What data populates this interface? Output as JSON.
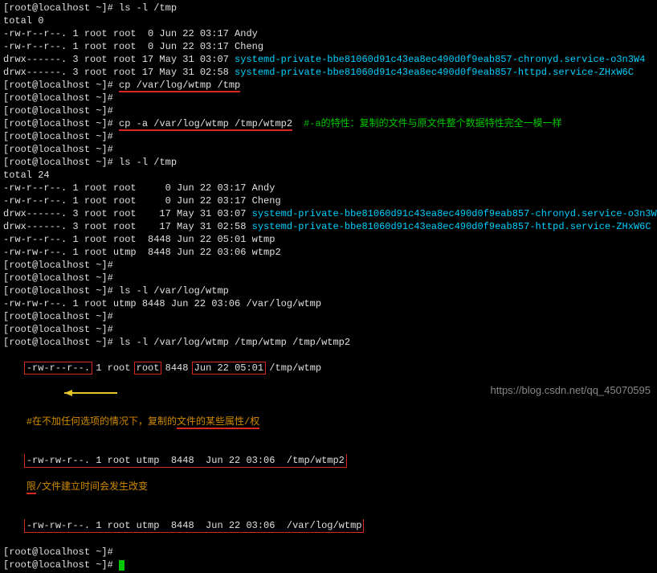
{
  "prompt": "[root@localhost ~]# ",
  "cmd": {
    "ls1": "ls -l /tmp",
    "cp1": "cp /var/log/wtmp /tmp",
    "cp2": "cp -a /var/log/wtmp /tmp/wtmp2",
    "ls2": "ls -l /tmp",
    "ls3": "ls -l /var/log/wtmp",
    "ls4": "ls -l /var/log/wtmp /tmp/wtmp /tmp/wtmp2"
  },
  "out": {
    "total0": "total 0",
    "total24": "total 24",
    "l01": "-rw-r--r--. 1 root root  0 Jun 22 03:17 Andy",
    "l02": "-rw-r--r--. 1 root root  0 Jun 22 03:17 Cheng",
    "l03a": "drwx------. 3 root root 17 May 31 03:07 ",
    "l03b": "systemd-private-bbe81060d91c43ea8ec490d0f9eab857-chronyd.service-o3n3W4",
    "l04a": "drwx------. 3 root root 17 May 31 02:58 ",
    "l04b": "systemd-private-bbe81060d91c43ea8ec490d0f9eab857-httpd.service-ZHxW6C",
    "l11": "-rw-r--r--. 1 root root     0 Jun 22 03:17 Andy",
    "l12": "-rw-r--r--. 1 root root     0 Jun 22 03:17 Cheng",
    "l13a": "drwx------. 3 root root    17 May 31 03:07 ",
    "l14a": "drwx------. 3 root root    17 May 31 02:58 ",
    "l15": "-rw-r--r--. 1 root root  8448 Jun 22 05:01 wtmp",
    "l16": "-rw-rw-r--. 1 root utmp  8448 Jun 22 03:06 wtmp2",
    "l21": "-rw-rw-r--. 1 root utmp 8448 Jun 22 03:06 /var/log/wtmp",
    "r1a": "-rw-r--r--.",
    "r1b": " 1 root ",
    "r1c": "root",
    "r1d": " 8448 ",
    "r1e": "Jun 22 05:01",
    "r1f": " /tmp/wtmp",
    "r2": "-rw-rw-r--. 1 root utmp  8448  Jun 22 03:06  /tmp/wtmp2",
    "r3": "-rw-rw-r--. 1 root utmp  8448  Jun 22 03:06  /var/log/wtmp"
  },
  "note": {
    "n1": "#-a的特性：复制的文件与原文件整个数据特性完全一模一样",
    "n2a": "#在不加任何选项的情况下，复制的",
    "n2b": "文件的某些属性/权",
    "n2c": "限",
    "n2d": "/文件建立时间会发生改变"
  },
  "watermark": "https://blog.csdn.net/qq_45070595"
}
